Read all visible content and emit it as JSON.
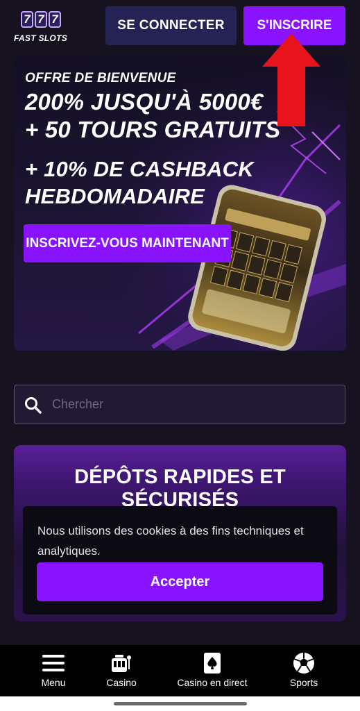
{
  "header": {
    "logo_digits": [
      "7",
      "7",
      "7"
    ],
    "logo_text": "FAST SLOTS",
    "login_label": "SE CONNECTER",
    "signup_label": "S'INSCRIRE"
  },
  "banner": {
    "kicker": "OFFRE DE BIENVENUE",
    "line1": "200% JUSQU'À 5000€",
    "line2": "+ 50 TOURS GRATUITS",
    "line3": "+ 10% DE CASHBACK",
    "line4": "HEBDOMADAIRE",
    "cta_label": "INSCRIVEZ-VOUS MAINTENANT"
  },
  "search": {
    "placeholder": "Chercher",
    "value": ""
  },
  "deposits": {
    "title": "DÉPÔTS RAPIDES ET SÉCURISÉS"
  },
  "cookie": {
    "text": "Nous utilisons des cookies à des fins techniques et analytiques.",
    "accept_label": "Accepter"
  },
  "bottom_nav": {
    "items": [
      {
        "label": "Menu",
        "icon": "hamburger-icon"
      },
      {
        "label": "Casino",
        "icon": "slot-machine-icon"
      },
      {
        "label": "Casino en direct",
        "icon": "playing-card-icon"
      },
      {
        "label": "Sports",
        "icon": "soccer-ball-icon"
      }
    ]
  },
  "colors": {
    "accent": "#8a13ff",
    "login_button": "#252254",
    "annotation_arrow": "#e8141c",
    "background": "#17121f"
  }
}
